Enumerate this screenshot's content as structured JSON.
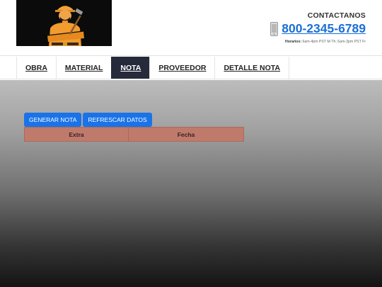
{
  "header": {
    "contact_title": "CONTACTANOS",
    "phone": "800-2345-6789",
    "hours_label": "Horarios:",
    "hours_text": "6am-4pm PST M-Th; 6am-3pm PST Fr"
  },
  "nav": {
    "items": [
      {
        "label": "OBRA"
      },
      {
        "label": "MATERIAL"
      },
      {
        "label": "NOTA",
        "active": true
      },
      {
        "label": "PROVEEDOR"
      },
      {
        "label": "DETALLE NOTA"
      }
    ]
  },
  "actions": {
    "generate_label": "GENERAR NOTA",
    "refresh_label": "REFRESCAR DATOS"
  },
  "table": {
    "columns": [
      "Extra",
      "Fecha"
    ]
  },
  "colors": {
    "primary_button": "#1a73e8",
    "nav_active": "#252b3a",
    "table_header": "#bf7a6c",
    "phone_link": "#1b6fd8"
  }
}
